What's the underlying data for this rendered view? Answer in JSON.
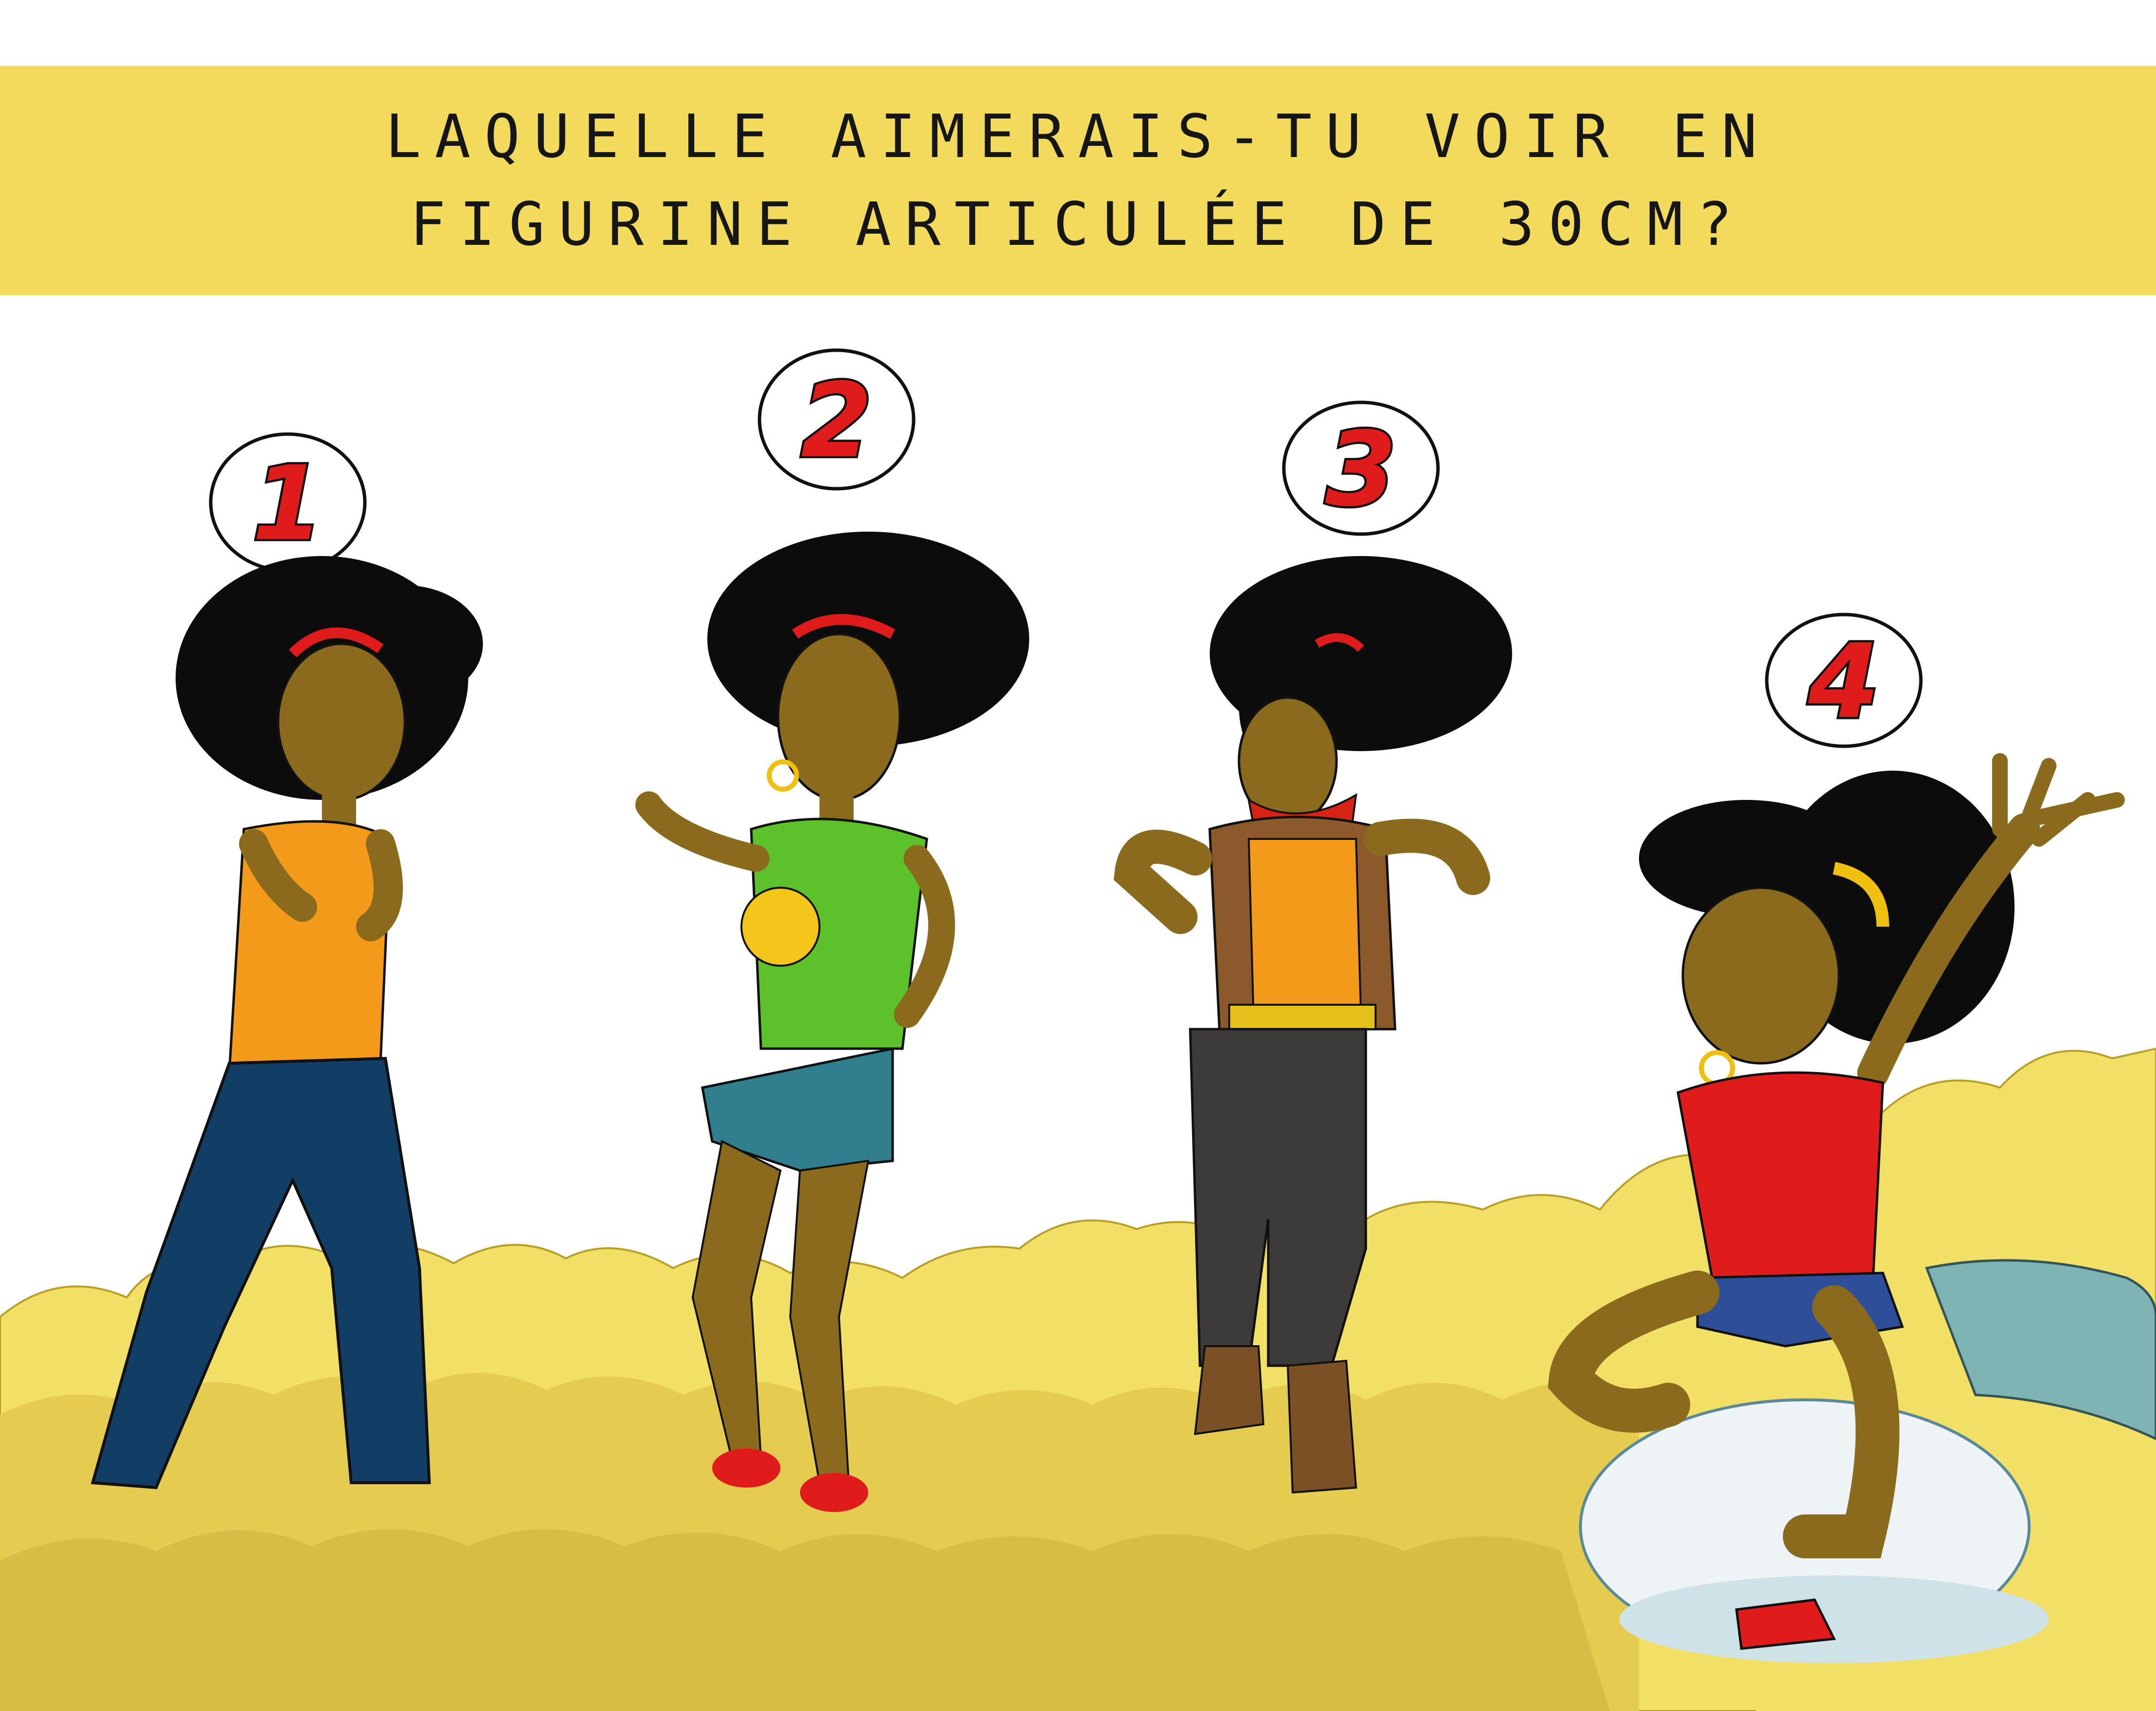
{
  "title": {
    "line1": "LAQUELLE AIMERAIS-TU VOIR EN",
    "line2": "FIGURINE ARTICULÉE DE 30CM?"
  },
  "choices": [
    {
      "number": "1"
    },
    {
      "number": "2"
    },
    {
      "number": "3"
    },
    {
      "number": "4"
    }
  ],
  "colors": {
    "banner": "#f2da5c",
    "cloud_light": "#f2df66",
    "cloud_dark": "#d9c24a",
    "number_red": "#e01b1b",
    "skin": "#8a6a1c",
    "hair": "#0c0c0c"
  }
}
